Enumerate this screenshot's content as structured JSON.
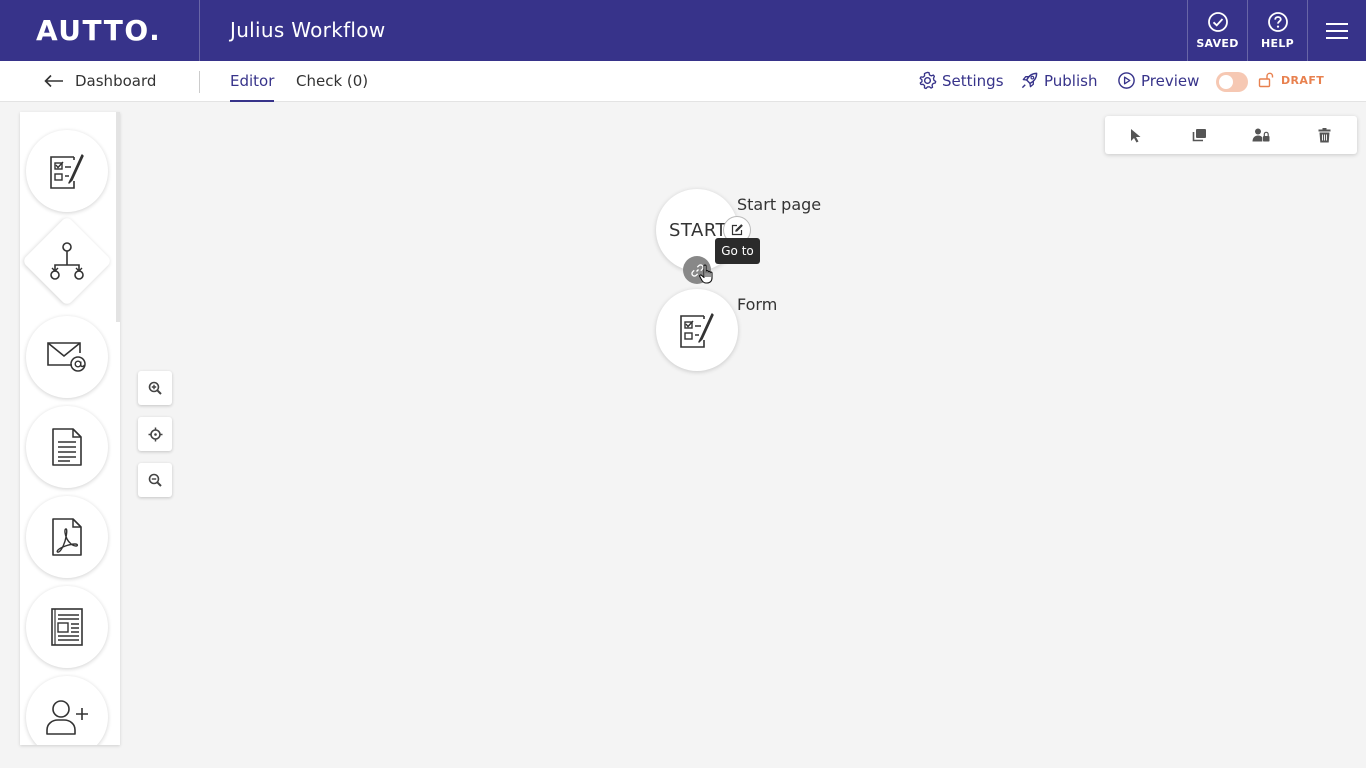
{
  "header": {
    "logo": "AUTTO.",
    "workflow_title": "Julius Workflow",
    "saved_label": "SAVED",
    "help_label": "HELP"
  },
  "subnav": {
    "back_label": "Dashboard",
    "tabs": [
      {
        "label": "Editor",
        "active": true
      },
      {
        "label": "Check (0)",
        "active": false
      }
    ],
    "actions": {
      "settings": "Settings",
      "publish": "Publish",
      "preview": "Preview"
    },
    "status": "DRAFT",
    "toggle_on": false
  },
  "palette": {
    "items": [
      "form-icon",
      "decision-branch-icon",
      "email-icon",
      "document-icon",
      "pdf-icon",
      "newsletter-icon",
      "add-user-icon"
    ]
  },
  "canvas": {
    "nodes": [
      {
        "type": "start",
        "text": "START",
        "label": "Start page"
      },
      {
        "type": "form",
        "label": "Form"
      }
    ],
    "tooltip": "Go to"
  },
  "colors": {
    "brand": "#37338a",
    "draft_accent": "#e8814f"
  }
}
